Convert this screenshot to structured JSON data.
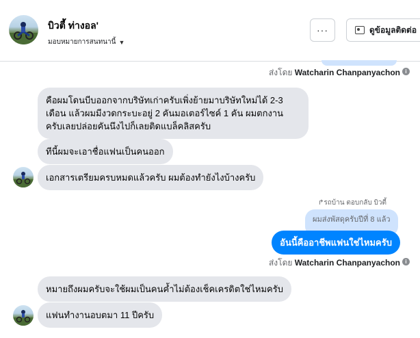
{
  "header": {
    "name": "บิวตี้ ท่างอล'",
    "subtitle": "มอบหมายการสนทนานี้",
    "more_label": "···",
    "contact_label": "ดูข้อมูลติดต่อ"
  },
  "sent_by": {
    "prefix": "ส่งโดย",
    "agent": "Watcharin Chanpanyachon",
    "info": "i"
  },
  "messages": {
    "in1_line1": "คือผมโดนบีบออกจากบริษัทเก่าครับเพิ่งย้ายมาบริษัทใหม่ได้ 2-3",
    "in1_line2": "เดือน แล้วผมมีงวดกระบะอยู่ 2 คันมอเตอร์ไซค์ 1 คัน ผมตกงาน",
    "in1_line3": "ครับเลยปล่อยคันนึงไปก็เลยติดแบล็คลิสครับ",
    "in2": "ทีนี้ผมจะเอาชื่อแฟนเป็นคนออก",
    "in3": "เอกสารเตรียมครบหมดแล้วครับ ผมต้องทำยังไงบ้างครับ",
    "reply_label": "↱รถบ้าน ตอบกลับ บิวตี้",
    "quoted": "ผมส่งพัสดุครับปีที่ 8 แล้ว",
    "out1": "อันนี้คืออาชีพแฟนใช่ไหมครับ",
    "in4": "หมายถึงผมครับจะใช้ผมเป็นคนค้ำไม่ต้องเช็คเครดิตใช่ไหมครับ",
    "in5": "แฟนทำงานอบตมา 11 ปีครับ"
  },
  "icons": {
    "more": "more-horizontal-icon",
    "contact": "contact-card-icon",
    "dropdown": "chevron-down-icon",
    "info": "info-icon"
  },
  "colors": {
    "outgoing_bubble": "#0084ff",
    "incoming_bubble": "#e4e6eb",
    "quoted_bubble": "#cfe3fd"
  }
}
